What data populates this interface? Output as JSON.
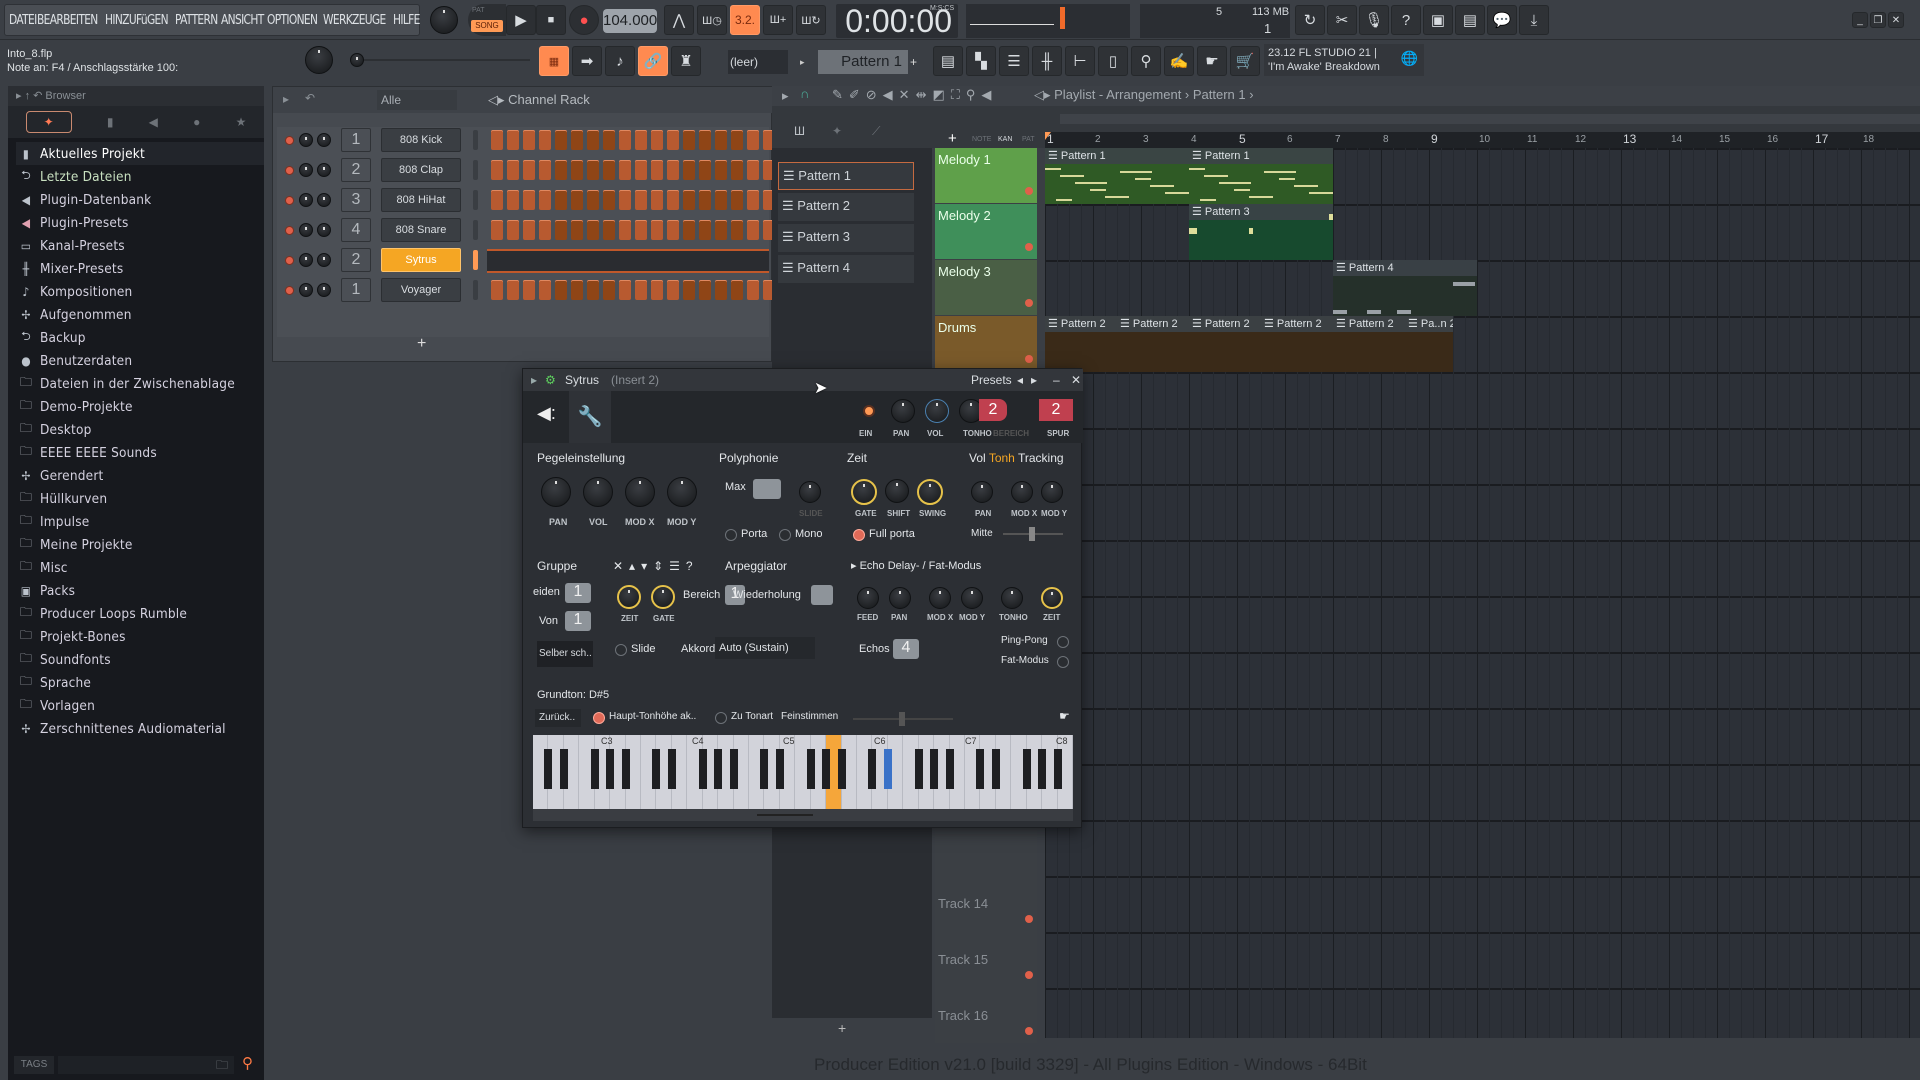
{
  "menu": [
    "DATEI",
    "BEARBEITEN",
    "HINZUFüGEN",
    "PATTERN",
    "ANSICHT",
    "OPTIONEN",
    "WERKZEUGE",
    "HILFE"
  ],
  "transport": {
    "pat_label": "PAT",
    "song_label": "SONG",
    "mode": "SONG",
    "tempo": "104.000",
    "time": "0:00:00",
    "time_format": "M:S:CS",
    "cpu_value": "5",
    "memory": "113 MB",
    "poly": "1",
    "accent": "#ff8a50"
  },
  "hint": {
    "file": "Into_8.flp",
    "message": "Note an: F4 / Anschlagsstärke 100:"
  },
  "pattern_selector": {
    "preset": "(leer)",
    "pattern": "Pattern 1"
  },
  "news": {
    "text": "23.12  FL STUDIO 21 | 'I'm Awake' Breakdown"
  },
  "window_controls": [
    "minimize",
    "restore",
    "close"
  ],
  "browser": {
    "title": "Browser",
    "items": [
      {
        "label": "Aktuelles Projekt",
        "icon": "file-icon"
      },
      {
        "label": "Letzte Dateien",
        "icon": "recent-folder-icon"
      },
      {
        "label": "Plugin-Datenbank",
        "icon": "plugin-icon"
      },
      {
        "label": "Plugin-Presets",
        "icon": "plugin-preset-icon"
      },
      {
        "label": "Kanal-Presets",
        "icon": "channel-icon"
      },
      {
        "label": "Mixer-Presets",
        "icon": "mixer-icon"
      },
      {
        "label": "Kompositionen",
        "icon": "note-icon"
      },
      {
        "label": "Aufgenommen",
        "icon": "waveform-icon"
      },
      {
        "label": "Backup",
        "icon": "backup-folder-icon"
      },
      {
        "label": "Benutzerdaten",
        "icon": "user-icon"
      },
      {
        "label": "Dateien in der Zwischenablage",
        "icon": "folder-icon"
      },
      {
        "label": "Demo-Projekte",
        "icon": "folder-icon"
      },
      {
        "label": "Desktop",
        "icon": "folder-icon"
      },
      {
        "label": "EEEE EEEE Sounds",
        "icon": "folder-icon"
      },
      {
        "label": "Gerendert",
        "icon": "render-icon"
      },
      {
        "label": "Hüllkurven",
        "icon": "folder-icon"
      },
      {
        "label": "Impulse",
        "icon": "folder-icon"
      },
      {
        "label": "Meine Projekte",
        "icon": "folder-icon"
      },
      {
        "label": "Misc",
        "icon": "folder-icon"
      },
      {
        "label": "Packs",
        "icon": "packs-icon"
      },
      {
        "label": "Producer Loops Rumble",
        "icon": "folder-icon"
      },
      {
        "label": "Projekt-Bones",
        "icon": "folder-icon"
      },
      {
        "label": "Soundfonts",
        "icon": "folder-icon"
      },
      {
        "label": "Sprache",
        "icon": "folder-icon"
      },
      {
        "label": "Vorlagen",
        "icon": "folder-icon"
      },
      {
        "label": "Zerschnittenes Audiomaterial",
        "icon": "waveform-icon"
      }
    ],
    "tags_label": "TAGS"
  },
  "channel_rack": {
    "title": "Channel Rack",
    "filter": "Alle",
    "channels": [
      {
        "num": "1",
        "name": "808 Kick",
        "selected": false
      },
      {
        "num": "2",
        "name": "808 Clap",
        "selected": false
      },
      {
        "num": "3",
        "name": "808 HiHat",
        "selected": false
      },
      {
        "num": "4",
        "name": "808 Snare",
        "selected": false
      },
      {
        "num": "2",
        "name": "Sytrus",
        "selected": true
      },
      {
        "num": "1",
        "name": "Voyager",
        "selected": false
      }
    ],
    "add_label": "+"
  },
  "playlist": {
    "title": "Playlist - Arrangement",
    "breadcrumb": "Pattern 1",
    "picker_tabs": [
      "NOTE",
      "KAN",
      "PAT"
    ],
    "patterns": [
      "Pattern 1",
      "Pattern 2",
      "Pattern 3",
      "Pattern 4"
    ],
    "ruler": [
      "1",
      "2",
      "3",
      "4",
      "5",
      "6",
      "7",
      "8",
      "9",
      "10",
      "11",
      "12",
      "13",
      "14",
      "15",
      "16",
      "17",
      "18"
    ],
    "tracks": [
      {
        "name": "Melody 1",
        "color": "#5fa04a"
      },
      {
        "name": "Melody 2",
        "color": "#3f8f5a"
      },
      {
        "name": "Melody 3",
        "color": "#4a5f45"
      },
      {
        "name": "Drums",
        "color": "#7a5a2a"
      },
      {
        "name": "Track 14",
        "color": "#3b3f44"
      },
      {
        "name": "Track 15",
        "color": "#3b3f44"
      },
      {
        "name": "Track 16",
        "color": "#3b3f44"
      }
    ],
    "clips": [
      {
        "track": 0,
        "label": "Pattern 1",
        "start": 1,
        "len": 3
      },
      {
        "track": 0,
        "label": "Pattern 1",
        "start": 4,
        "len": 3
      },
      {
        "track": 1,
        "label": "Pattern 3",
        "start": 4,
        "len": 3
      },
      {
        "track": 2,
        "label": "Pattern 4",
        "start": 7,
        "len": 3
      },
      {
        "track": 3,
        "label": "Pattern 2",
        "start": 1,
        "len": 1.5
      },
      {
        "track": 3,
        "label": "Pattern 2",
        "start": 2.5,
        "len": 1.5
      },
      {
        "track": 3,
        "label": "Pattern 2",
        "start": 4,
        "len": 1.5
      },
      {
        "track": 3,
        "label": "Pattern 2",
        "start": 5.5,
        "len": 1.5
      },
      {
        "track": 3,
        "label": "Pattern 2",
        "start": 7,
        "len": 1.5
      },
      {
        "track": 3,
        "label": "Pa..n 2",
        "start": 8.5,
        "len": 1
      }
    ]
  },
  "sytrus": {
    "title": "Sytrus",
    "insert": "(Insert 2)",
    "presets_label": "Presets",
    "top_knobs": [
      "EIN",
      "PAN",
      "VOL",
      "TONHO",
      "BEREICH",
      "SPUR"
    ],
    "range_value": "2",
    "track_value": "2",
    "level": {
      "title": "Pegeleinstellung",
      "knobs": [
        "PAN",
        "VOL",
        "MOD X",
        "MOD Y"
      ]
    },
    "poly": {
      "title": "Polyphonie",
      "max_label": "Max",
      "slide_label": "SLIDE",
      "porta": "Porta",
      "mono": "Mono"
    },
    "time": {
      "title": "Zeit",
      "knobs": [
        "GATE",
        "SHIFT",
        "SWING"
      ],
      "full_porta": "Full porta"
    },
    "tracking": {
      "vol": "Vol",
      "tonh": "Tonh",
      "tracking": "Tracking",
      "knobs": [
        "PAN",
        "MOD X",
        "MOD Y"
      ],
      "mitte": "Mitte"
    },
    "group": {
      "title": "Gruppe",
      "cut_label": "eiden",
      "cut_value": "1",
      "by_label": "Von",
      "by_value": "1",
      "self_label": "Selber sch.."
    },
    "arp": {
      "title": "Arpeggiator",
      "knobs": [
        "ZEIT",
        "GATE"
      ],
      "range_label": "Bereich",
      "range_value": "1",
      "repeat_label": "Wiederholung",
      "slide": "Slide",
      "chord_label": "Akkord",
      "chord_value": "Auto (Sustain)"
    },
    "echo": {
      "title": "Echo Delay- / Fat-Modus",
      "knobs": [
        "FEED",
        "PAN",
        "MOD X",
        "MOD Y",
        "TONHO",
        "ZEIT"
      ],
      "echos_label": "Echos",
      "echos_value": "4",
      "ping_pong": "Ping-Pong",
      "fat": "Fat-Modus"
    },
    "root": {
      "label": "Grundton: D#5",
      "reset": "Zurück..",
      "main_pitch": "Haupt-Tonhöhe ak..",
      "to_key": "Zu Tonart",
      "fine": "Feinstimmen"
    },
    "piano_labels": [
      "C3",
      "C4",
      "C5",
      "C6",
      "C7",
      "C8"
    ]
  },
  "status_bar": "Producer Edition v21.0 [build 3329] - All Plugins Edition - Windows - 64Bit"
}
